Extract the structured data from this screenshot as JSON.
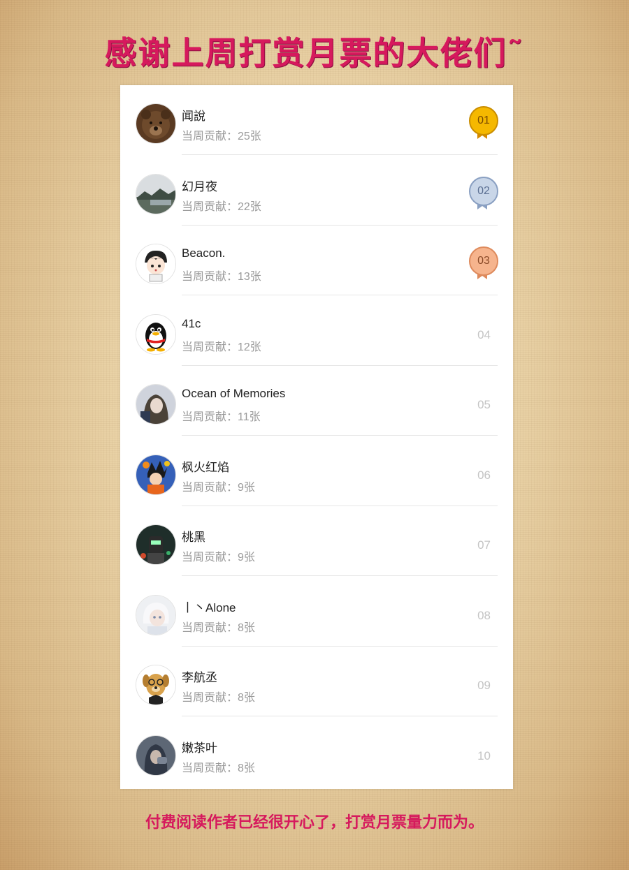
{
  "header": {
    "title": "感谢上周打赏月票的大佬们˜"
  },
  "footer": {
    "text": "付费阅读作者已经很开心了，打赏月票量力而为。"
  },
  "colors": {
    "accent": "#d6195d",
    "gold": "#f2b400",
    "silver": "#9fb3d1",
    "bronze": "#f0a57a"
  },
  "supporters": [
    {
      "name": "闻說",
      "contribution": "当周贡献：25张",
      "rank": "01",
      "medal": "gold",
      "avatar": "bear-avatar"
    },
    {
      "name": "幻月夜",
      "contribution": "当周贡献：22张",
      "rank": "02",
      "medal": "silver",
      "avatar": "landscape-avatar"
    },
    {
      "name": "Beacon.",
      "contribution": "当周贡献：13张",
      "rank": "03",
      "medal": "bronze",
      "avatar": "cartoon-boy-avatar"
    },
    {
      "name": "41c",
      "contribution": "当周贡献：12张",
      "rank": "04",
      "medal": "",
      "avatar": "penguin-avatar"
    },
    {
      "name": "Ocean of Memories",
      "contribution": "当周贡献：11张",
      "rank": "05",
      "medal": "",
      "avatar": "anime-girl-avatar"
    },
    {
      "name": "枫火红焰",
      "contribution": "当周贡献：9张",
      "rank": "06",
      "medal": "",
      "avatar": "anime-fighter-avatar"
    },
    {
      "name": "桃黑",
      "contribution": "当周贡献：9张",
      "rank": "07",
      "medal": "",
      "avatar": "dark-figure-avatar"
    },
    {
      "name": "丨丶Alone",
      "contribution": "当周贡献：8张",
      "rank": "08",
      "medal": "",
      "avatar": "white-hair-avatar"
    },
    {
      "name": "李航丞",
      "contribution": "当周贡献：8张",
      "rank": "09",
      "medal": "",
      "avatar": "dog-avatar"
    },
    {
      "name": "嫩茶叶",
      "contribution": "当周贡献：8张",
      "rank": "10",
      "medal": "",
      "avatar": "hooded-avatar"
    }
  ]
}
